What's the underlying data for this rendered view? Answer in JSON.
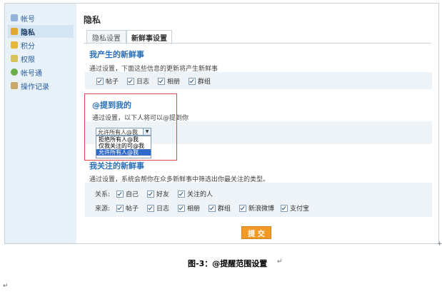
{
  "sidebar": {
    "items": [
      {
        "label": "帐号",
        "icon": "id-card-icon",
        "active": false
      },
      {
        "label": "隐私",
        "icon": "lock-icon",
        "active": true
      },
      {
        "label": "积分",
        "icon": "coins-icon",
        "active": false
      },
      {
        "label": "权限",
        "icon": "permission-icon",
        "active": false
      },
      {
        "label": "帐号通",
        "icon": "link-icon",
        "active": false
      },
      {
        "label": "操作记录",
        "icon": "edit-log-icon",
        "active": false
      }
    ]
  },
  "header": {
    "title": "隐私"
  },
  "tabs": [
    {
      "label": "隐私设置",
      "active": false
    },
    {
      "label": "新鲜事设置",
      "active": true
    }
  ],
  "section_mine": {
    "title": "我产生的新鲜事",
    "desc": "通过设置，下面这些信息的更新将产生新鲜事",
    "options": [
      "帖子",
      "日志",
      "相册",
      "群组"
    ]
  },
  "section_mention": {
    "title": "@提到我的",
    "desc": "通过设置，以下人将可以@提到你",
    "select_value": "允许所有人@我",
    "dropdown_options": [
      "拒绝所有人@我",
      "仅我关注的可@我",
      "允许所有人@我"
    ],
    "selected_index": 2
  },
  "section_follow": {
    "title": "我关注的新鲜事",
    "desc": "通过设置，系统会帮你在众多新鲜事中筛选出你最关注的类型。",
    "relation_label": "关系:",
    "relation_options": [
      "自己",
      "好友",
      "关注的人"
    ],
    "source_label": "来源:",
    "source_options": [
      "帖子",
      "日志",
      "相册",
      "群组",
      "新浪微博",
      "支付宝"
    ]
  },
  "submit_label": "提 交",
  "caption": "图-3：@提醒范围设置",
  "colors": {
    "accent": "#2a6fb7",
    "submit": "#f29a25",
    "highlight_border": "#e0464a",
    "sidebar_bg": "#e8f1f8"
  }
}
